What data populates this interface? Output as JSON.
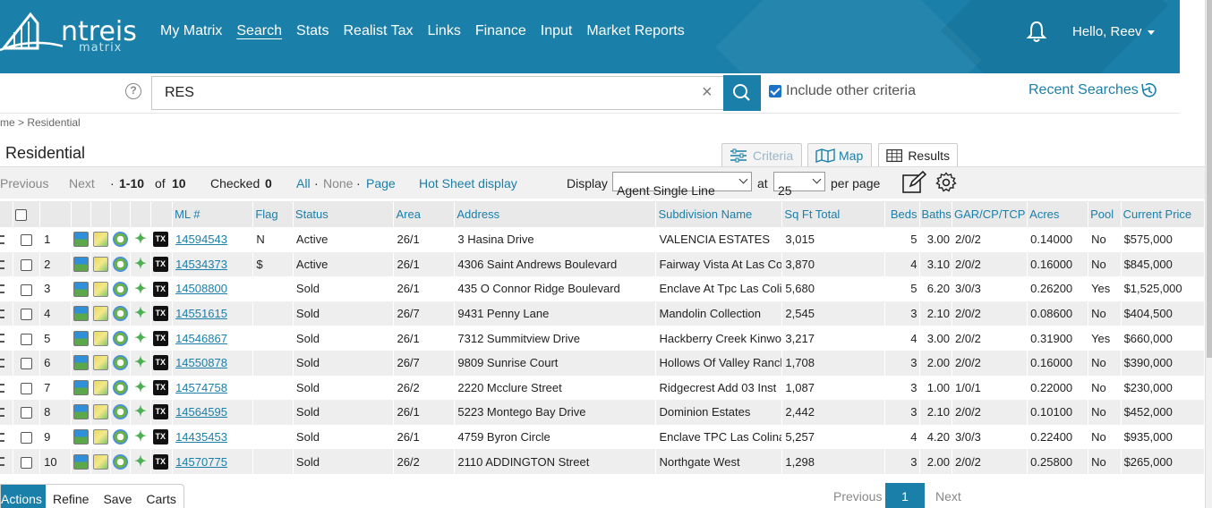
{
  "header": {
    "logo_text": "ntreis",
    "logo_sub": "matrix",
    "nav": [
      "My Matrix",
      "Search",
      "Stats",
      "Realist Tax",
      "Links",
      "Finance",
      "Input",
      "Market Reports"
    ],
    "current_nav": "Search",
    "user_greeting": "Hello, Reev",
    "bell_icon": "bell-icon"
  },
  "search": {
    "help": "?",
    "value": "RES",
    "clear": "×",
    "include_other_label": "Include other criteria",
    "include_other_checked": true,
    "recent_label": "Recent Searches"
  },
  "breadcrumb": "me > Residential",
  "page_title": "Residential",
  "view_tabs": {
    "criteria": "Criteria",
    "map": "Map",
    "results": "Results"
  },
  "toolbar": {
    "previous": "Previous",
    "next": "Next",
    "range_prefix": "·",
    "range": "1-10",
    "of": "of",
    "total": "10",
    "checked_label": "Checked",
    "checked_count": "0",
    "all": "All",
    "dot1": "·",
    "none": "None",
    "dot2": "·",
    "page": "Page",
    "hot_sheet": "Hot Sheet display",
    "display_label": "Display",
    "display_value": "Agent Single Line",
    "at_label": "at",
    "per_page_value": "25",
    "per_page_label": "per page"
  },
  "table": {
    "headers": {
      "ml": "ML #",
      "flag": "Flag",
      "status": "Status",
      "area": "Area",
      "address": "Address",
      "subdivision": "Subdivision Name",
      "sqft": "Sq Ft Total",
      "beds": "Beds",
      "baths": "Baths",
      "gar": "GAR/CP/TCP",
      "acres": "Acres",
      "pool": "Pool",
      "price": "Current Price"
    },
    "rows": [
      {
        "n": "1",
        "ml": "14594543",
        "flag": "N",
        "status": "Active",
        "area": "26/1",
        "address": "3 Hasina Drive",
        "subdivision": "VALENCIA ESTATES",
        "sqft": "3,015",
        "beds": "5",
        "baths": "3.00",
        "gar": "2/0/2",
        "acres": "0.14000",
        "pool": "No",
        "price": "$575,000"
      },
      {
        "n": "2",
        "ml": "14534373",
        "flag": "$",
        "status": "Active",
        "area": "26/1",
        "address": "4306 Saint Andrews Boulevard",
        "subdivision": "Fairway Vista At Las Colinas",
        "sqft": "3,870",
        "beds": "4",
        "baths": "3.10",
        "gar": "2/0/2",
        "acres": "0.16000",
        "pool": "No",
        "price": "$845,000"
      },
      {
        "n": "3",
        "ml": "14508800",
        "flag": "",
        "status": "Sold",
        "area": "26/1",
        "address": "435 O Connor Ridge Boulevard",
        "subdivision": "Enclave At Tpc Las Colinas",
        "sqft": "5,680",
        "beds": "5",
        "baths": "6.20",
        "gar": "3/0/3",
        "acres": "0.26200",
        "pool": "Yes",
        "price": "$1,525,000"
      },
      {
        "n": "4",
        "ml": "14551615",
        "flag": "",
        "status": "Sold",
        "area": "26/7",
        "address": "9431 Penny Lane",
        "subdivision": "Mandolin Collection",
        "sqft": "2,545",
        "beds": "3",
        "baths": "2.10",
        "gar": "2/0/2",
        "acres": "0.08600",
        "pool": "No",
        "price": "$404,500"
      },
      {
        "n": "5",
        "ml": "14546867",
        "flag": "",
        "status": "Sold",
        "area": "26/1",
        "address": "7312 Summitview Drive",
        "subdivision": "Hackberry Creek Kinwood",
        "sqft": "3,217",
        "beds": "4",
        "baths": "3.00",
        "gar": "2/0/2",
        "acres": "0.31900",
        "pool": "Yes",
        "price": "$660,000"
      },
      {
        "n": "6",
        "ml": "14550878",
        "flag": "",
        "status": "Sold",
        "area": "26/7",
        "address": "9809 Sunrise Court",
        "subdivision": "Hollows Of Valley Ranch",
        "sqft": "1,708",
        "beds": "3",
        "baths": "2.00",
        "gar": "2/0/2",
        "acres": "0.16000",
        "pool": "No",
        "price": "$390,000"
      },
      {
        "n": "7",
        "ml": "14574758",
        "flag": "",
        "status": "Sold",
        "area": "26/2",
        "address": "2220 Mcclure Street",
        "subdivision": "Ridgecrest Add 03 Inst",
        "sqft": "1,087",
        "beds": "3",
        "baths": "1.00",
        "gar": "1/0/1",
        "acres": "0.22000",
        "pool": "No",
        "price": "$230,000"
      },
      {
        "n": "8",
        "ml": "14564595",
        "flag": "",
        "status": "Sold",
        "area": "26/1",
        "address": "5223 Montego Bay Drive",
        "subdivision": "Dominion Estates",
        "sqft": "2,442",
        "beds": "3",
        "baths": "2.10",
        "gar": "2/0/2",
        "acres": "0.10100",
        "pool": "No",
        "price": "$452,000"
      },
      {
        "n": "9",
        "ml": "14435453",
        "flag": "",
        "status": "Sold",
        "area": "26/1",
        "address": "4759 Byron Circle",
        "subdivision": "Enclave TPC Las Colinas",
        "sqft": "5,257",
        "beds": "4",
        "baths": "4.20",
        "gar": "3/0/3",
        "acres": "0.22400",
        "pool": "No",
        "price": "$935,000"
      },
      {
        "n": "10",
        "ml": "14570775",
        "flag": "",
        "status": "Sold",
        "area": "26/2",
        "address": "2110 ADDINGTON Street",
        "subdivision": "Northgate West",
        "sqft": "1,298",
        "beds": "3",
        "baths": "2.00",
        "gar": "2/0/2",
        "acres": "0.25800",
        "pool": "No",
        "price": "$265,000"
      }
    ]
  },
  "bottom_tabs": [
    "Actions",
    "Refine",
    "Save",
    "Carts"
  ],
  "pager": {
    "previous": "Previous",
    "current": "1",
    "next": "Next"
  },
  "colors": {
    "brand": "#1a7fa9",
    "row_alt": "#eeeeee"
  }
}
